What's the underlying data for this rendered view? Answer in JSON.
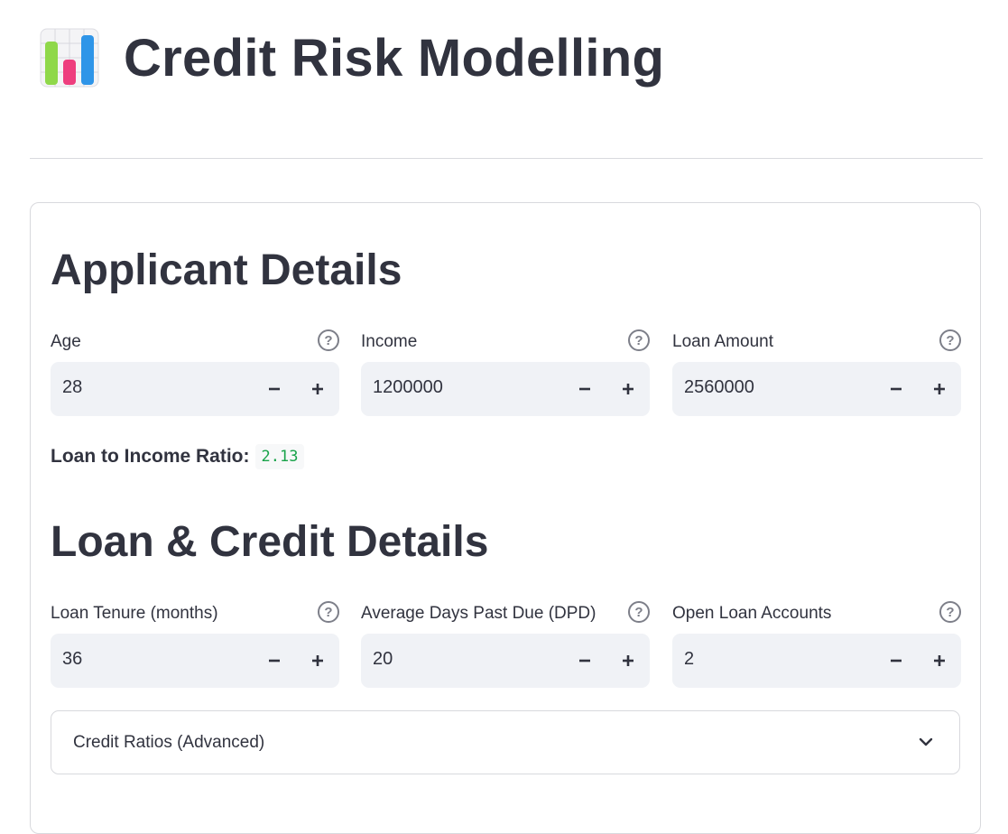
{
  "app": {
    "title": "Credit Risk Modelling",
    "icon": "bar-chart-emoji-icon"
  },
  "applicant": {
    "heading": "Applicant Details",
    "fields": [
      {
        "label": "Age",
        "value": "28"
      },
      {
        "label": "Income",
        "value": "1200000"
      },
      {
        "label": "Loan Amount",
        "value": "2560000"
      }
    ],
    "ratio_label": "Loan to Income Ratio:",
    "ratio_value": "2.13"
  },
  "loan_credit": {
    "heading": "Loan & Credit Details",
    "fields": [
      {
        "label": "Loan Tenure (months)",
        "value": "36"
      },
      {
        "label": "Average Days Past Due (DPD)",
        "value": "20"
      },
      {
        "label": "Open Loan Accounts",
        "value": "2"
      }
    ]
  },
  "expander": {
    "label": "Credit Ratios (Advanced)",
    "icon": "chevron-down-icon"
  },
  "icons": {
    "help": "?",
    "help_icon": "help-circle-icon",
    "minus_icon": "minus-icon",
    "plus_icon": "plus-icon"
  },
  "colors": {
    "text": "#31333f",
    "input_bg": "#f0f2f6",
    "border": "#d8d9dd",
    "ratio_value": "#19a34a",
    "chart_green": "#8fd84a",
    "chart_pink": "#ee3e7e",
    "chart_blue": "#2f95e8"
  }
}
